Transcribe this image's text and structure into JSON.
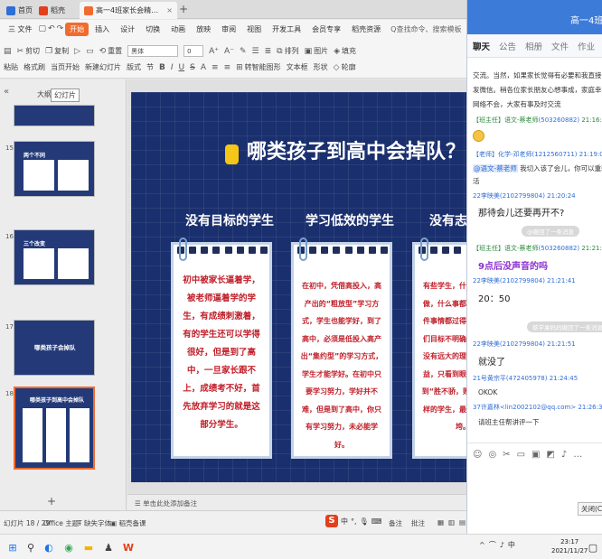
{
  "tabs": [
    {
      "label": "首页"
    },
    {
      "label": "稻壳"
    },
    {
      "label": "高一4班家长会精品(1).pptx"
    }
  ],
  "menu": {
    "file_label": "三 文件",
    "items": [
      "开始",
      "插入",
      "设计",
      "切换",
      "动画",
      "放映",
      "审阅",
      "视图",
      "开发工具",
      "会员专享",
      "稻壳资源"
    ],
    "search": "Q查找命令、搜索模板"
  },
  "toolbar": {
    "row1": [
      "粘贴",
      "剪切",
      "复制",
      "格式刷",
      "当页开始",
      "新建幻灯片",
      "版式",
      "节"
    ],
    "font_name": "黑体",
    "font_size": "0",
    "arrange_label": "排列",
    "textbox_label": "文本框",
    "shape_label": "形状",
    "insert_picture_label": "图片",
    "row2_extra": [
      "重置",
      "转智能图形"
    ],
    "fill_label": "填充",
    "outline_label": "轮廓"
  },
  "left_panel": {
    "tab_outline": "大纲",
    "tab_slides": "幻灯片",
    "thumbs": [
      {
        "num": "",
        "caption": ""
      },
      {
        "num": "15",
        "caption": "两个不同"
      },
      {
        "num": "16",
        "caption": "三个改变"
      },
      {
        "num": "17",
        "caption": "哪类孩子会掉队"
      },
      {
        "num": "18",
        "caption": "哪类孩子到高中会掉队"
      }
    ]
  },
  "slide": {
    "title": "哪类孩子到高中会掉队？",
    "columns": [
      {
        "heading": "没有目标的学生",
        "text": "初中被家长逼着学，被老师逼着学的学生，有成绩刺激着，有的学生还可以学得很好，但是到了高中，一旦家长跟不上，成绩考不好，首先放弃学习的就是这部分学生。"
      },
      {
        "heading": "学习低效的学生",
        "text": "在初中，凭借高投入，高产出的“粗放型”学习方式，学生也能学好，到了高中，必须是低投入高产出“集约型”的学习方式，学生才能学好。在初中只要学习努力，学好并不难，但是到了高中，你只有学习努力，未必能学好。"
      },
      {
        "heading": "没有志向的学生",
        "text": "有些学生，什么事都不想做，什么事都做不好，每件事情都过得去就好，他们目标不明确，但是一定没有远大的理想，眼前利益，只看到眼前，不能做到“胜不骄，败不馁”，这样的学生，最后被困难击垮。"
      }
    ]
  },
  "notes_placeholder": "单击此处添加备注",
  "status": {
    "slide_counter": "幻灯片 18 / 29",
    "theme": "Office 主题",
    "font_missing": "缺失字体",
    "doc_backup": "稻壳备课",
    "notes_label": "备注",
    "comment_label": "批注"
  },
  "chat": {
    "title": "高一4班网",
    "tabs": [
      "聊天",
      "公告",
      "相册",
      "文件",
      "作业",
      "设置"
    ],
    "messages": [
      {
        "type": "text",
        "lines": [
          "交流。当然，如果家长觉得有必要和我直接交流，也",
          "发微信。稍各位家长朋友心想事成，家庭幸福。",
          "网络不会，大家有事及时交流"
        ]
      },
      {
        "type": "sender",
        "name": "【班主任】语文-蔡老师",
        "uid": "(503260882)",
        "time": "21:16:31"
      },
      {
        "type": "emoji"
      },
      {
        "type": "sender",
        "name": "【老师】化学-邓老师",
        "uid": "(1212560711)",
        "time": "21:19:03",
        "blue": true
      },
      {
        "type": "mention",
        "mention": "@语文-蔡老师",
        "text": "我切入该了会儿，你可以重新连线，非",
        "cont": "活"
      },
      {
        "type": "sender",
        "name": "22李映美",
        "uid": "(2102799804)",
        "time": "21:20:24",
        "blue": true
      },
      {
        "type": "big",
        "text": "那待会儿还要再开不?"
      },
      {
        "type": "system",
        "text": "@撤回了一条消息"
      },
      {
        "type": "sender",
        "name": "【班主任】语文-蔡老师",
        "uid": "(503260882)",
        "time": "21:21:17"
      },
      {
        "type": "big",
        "text": "9点后没声音的吗",
        "purple": true
      },
      {
        "type": "sender",
        "name": "22李映美",
        "uid": "(2102799804)",
        "time": "21:21:41",
        "blue": true
      },
      {
        "type": "big",
        "text": "20：50"
      },
      {
        "type": "system",
        "text": "蔡学果妈妈撤回了一条消息"
      },
      {
        "type": "sender",
        "name": "22李映美",
        "uid": "(2102799804)",
        "time": "21:21:51",
        "blue": true
      },
      {
        "type": "big",
        "text": "就没了"
      },
      {
        "type": "sender",
        "name": "21号黄宗平",
        "uid": "(472405978)",
        "time": "21:24:45",
        "blue": true
      },
      {
        "type": "text",
        "lines": [
          "OKOK"
        ]
      },
      {
        "type": "sender",
        "name": "37许嘉林",
        "uid": "<lin2002102@qq.com>",
        "time": "21:26:32",
        "blue": true
      },
      {
        "type": "text",
        "lines": [
          "请班主任帮讲评一下"
        ]
      }
    ],
    "close_label": "关闭(C)"
  },
  "taskbar": {
    "time": "23:17",
    "date": "2021/11/27"
  }
}
